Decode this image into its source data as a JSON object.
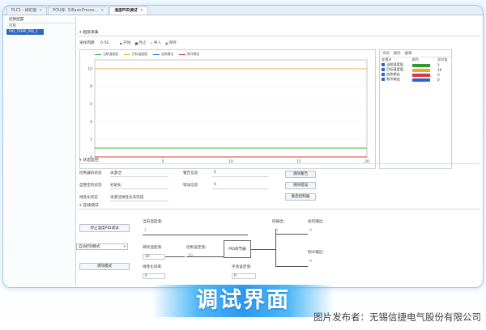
{
  "tabs": [
    {
      "label": "PLC1 - 梯形图",
      "active": false
    },
    {
      "label": "POU库: 3(BasicProces...",
      "active": false
    },
    {
      "label": "温度PID调试",
      "active": true
    }
  ],
  "left_panel": {
    "header": "控制配置",
    "subheader": "名称",
    "items": [
      "PID_TEMP_PID_1"
    ]
  },
  "trend": {
    "section_title": "趋势采集",
    "sample_label": "采样周期:",
    "sample_value": "0.5S",
    "buttons": [
      "开始",
      "停止",
      "导入",
      "保存"
    ]
  },
  "chart_data": {
    "type": "line",
    "legend": [
      "当前温度值",
      "目标温度值",
      "加热输出",
      "制冷输出"
    ],
    "x_ticks": [
      "5",
      "10",
      "15",
      "20"
    ],
    "y_ticks": [
      "10",
      "8",
      "6",
      "4",
      "2",
      "0"
    ],
    "xlim": [
      0,
      20
    ],
    "ylim": [
      0,
      11
    ],
    "series": [
      {
        "name": "当前温度值",
        "color": "#3aa03a",
        "x": [
          0,
          20
        ],
        "y": [
          1.0,
          1.0
        ]
      },
      {
        "name": "目标温度值",
        "color": "#f2a43a",
        "x": [
          0,
          20
        ],
        "y": [
          10.0,
          10.0
        ]
      },
      {
        "name": "加热输出",
        "color": "#2d7fe0",
        "x": [
          0,
          20
        ],
        "y": [
          0,
          0
        ]
      },
      {
        "name": "制冷输出",
        "color": "#d83a3a",
        "x": [
          0,
          20
        ],
        "y": [
          0,
          0
        ]
      }
    ]
  },
  "side_panel": {
    "tools": [
      "添加",
      "删除",
      "编辑"
    ],
    "columns": [
      "变量名",
      "颜色",
      "实时值"
    ],
    "rows": [
      {
        "name": "当前温度值",
        "color": "#2e9a2e",
        "value": "1"
      },
      {
        "name": "目标温度值",
        "color": "#f2a43a",
        "value": "10"
      },
      {
        "name": "加热输出",
        "color": "#d83a3a",
        "value": "0"
      },
      {
        "name": "制冷输出",
        "color": "#2d5fe0",
        "value": "0"
      }
    ]
  },
  "status": {
    "section_title": "状态监控",
    "fields": [
      {
        "label": "控制器的状态",
        "value": "未激活"
      },
      {
        "label": "自整定的状态",
        "value": "初始化"
      },
      {
        "label": "线性化状态",
        "value": "未激活线性化未完成"
      }
    ],
    "codes": [
      {
        "label": "警告信息",
        "value": "0"
      },
      {
        "label": "错误信息",
        "value": "0"
      }
    ],
    "buttons": [
      "清除警告",
      "清除错误",
      "重启控制器"
    ]
  },
  "online": {
    "section_title": "在线调试",
    "start_button": "停止温度PID调试",
    "mode_value": "自动控制模式",
    "clear_button": "清除模式",
    "current_temp_label": "当前温度值:",
    "current_temp_value": "1",
    "target_temp_label": "目标温度值:",
    "target_temp_value": "10",
    "target_temp_out": "10",
    "linear_label": "线性化斜率:",
    "linear_value": "0",
    "pid_label": "PID调节器",
    "manual_label": "手动设定值:",
    "manual_value": "0",
    "pid_out_label": "控制设定值:",
    "pid_out_value": "0",
    "output_label": "控输出:",
    "output_value": "0",
    "heat_label": "加热输出:",
    "heat_value": "0",
    "cool_label": "制冷输出:",
    "cool_value": "0"
  },
  "banner": "调试界面",
  "caption": "图片发布者：无锡信捷电气股份有限公司"
}
